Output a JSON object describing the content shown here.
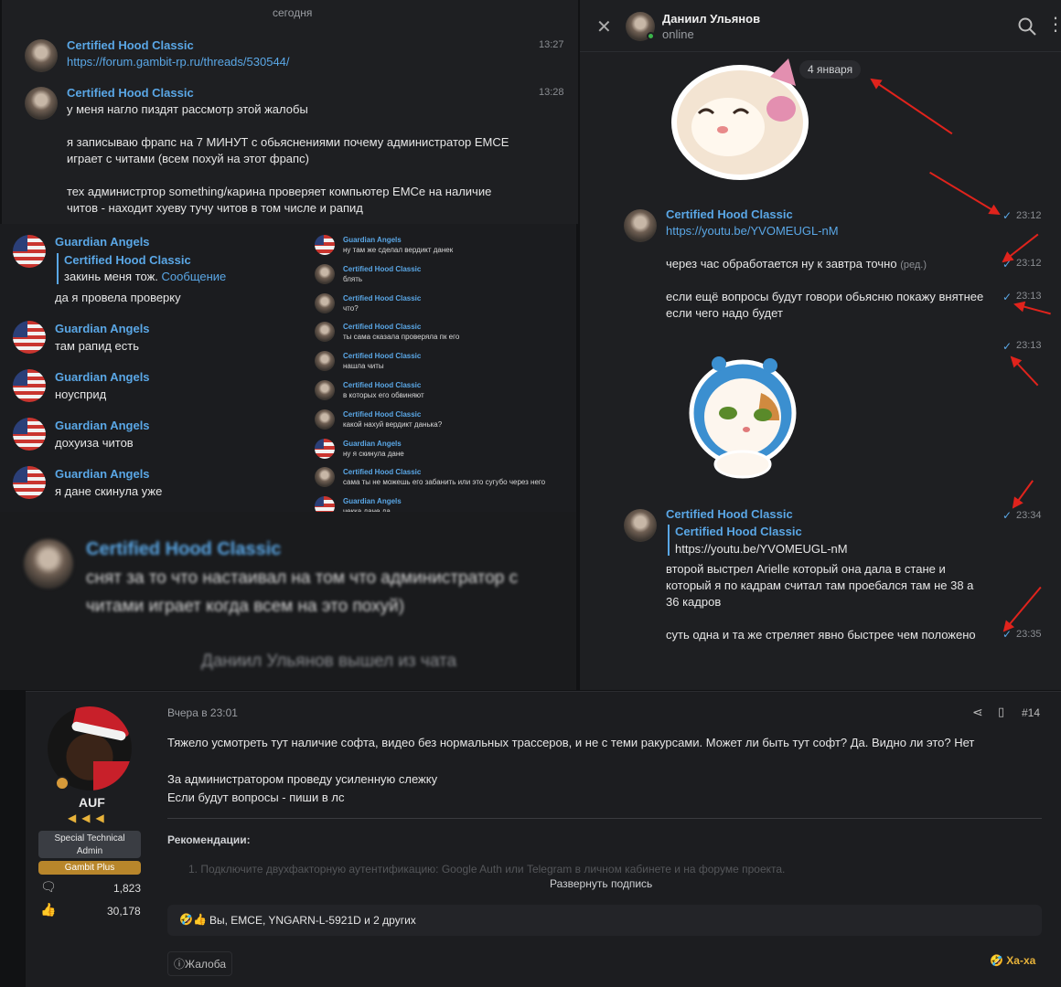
{
  "topleft": {
    "date": "сегодня",
    "msgs": [
      {
        "name": "Certified Hood Classic",
        "time": "13:27",
        "lines": [
          "https://forum.gambit-rp.ru/threads/530544/"
        ]
      },
      {
        "name": "Certified Hood Classic",
        "time": "13:28",
        "lines": [
          "у меня нагло пиздят рассмотр этой жалобы",
          "",
          "я записываю фрапс на 7 МИНУТ с обьяснениями почему администратор EMCE",
          "играет с читами (всем похуй на этот фрапс)",
          "",
          "тех администртор something/карина проверяет компьютер EMCe на наличие",
          "читов - находит хуеву тучу читов в том числе и рапид"
        ]
      }
    ]
  },
  "midleft": {
    "msgs": [
      {
        "name": "Guardian Angels",
        "reply_name": "Certified Hood Classic",
        "reply_text": "закинь меня тож.",
        "reply_link": "Сообщение",
        "text": "да я провела проверку"
      },
      {
        "name": "Guardian Angels",
        "text": "там рапид есть"
      },
      {
        "name": "Guardian Angels",
        "text": "ноусприд"
      },
      {
        "name": "Guardian Angels",
        "text": "дохуиза читов"
      },
      {
        "name": "Guardian Angels",
        "text": "я дане скинула уже"
      }
    ],
    "small": [
      {
        "name": "Guardian Angels",
        "text": "ну там же сделал вердикт данек"
      },
      {
        "name": "Certified Hood Classic",
        "text": "блять"
      },
      {
        "name": "Certified Hood Classic",
        "text": "что?"
      },
      {
        "name": "Certified Hood Classic",
        "text": "ты сама сказала проверяла пк его"
      },
      {
        "name": "Certified Hood Classic",
        "text": "нашла читы"
      },
      {
        "name": "Certified Hood Classic",
        "text": "в которых его обвиняют"
      },
      {
        "name": "Certified Hood Classic",
        "text": "какой нахуй вердикт данька?"
      },
      {
        "name": "Guardian Angels",
        "text": "ну я скинула дане"
      },
      {
        "name": "Certified Hood Classic",
        "text": "сама ты не можешь его забанить или это сугубо через него"
      },
      {
        "name": "Guardian Angels",
        "text": "чекка дане да"
      }
    ]
  },
  "blurred": {
    "name": "Certified Hood Classic",
    "line1": "снят за то что настаивал на том что администратор с",
    "line2": "читами играет когда всем на это похуй)",
    "left": "Даниил Ульянов вышел из чата"
  },
  "right": {
    "contact": "Даниил Ульянов",
    "status": "online",
    "date_chip": "4 января",
    "m1": {
      "name": "Certified Hood Classic",
      "link": "https://youtu.be/YVOMEUGL-nM",
      "time": "23:12"
    },
    "m2": {
      "text": "через час обработается ну к завтра точно",
      "edited": "(ред.)",
      "time": "23:12"
    },
    "m3": {
      "l1": "если ещё вопросы будут говори обьясню покажу внятнее",
      "l2": "если чего надо будет",
      "time": "23:13"
    },
    "m4": {
      "time": "23:13"
    },
    "m5": {
      "name": "Certified Hood Classic",
      "reply_name": "Certified Hood Classic",
      "reply_text": "https://youtu.be/YVOMEUGL-nM",
      "l1": "второй выстрел Arielle который она дала в стане и",
      "l2": "который я по кадрам считал там проебался там не 38 а",
      "l3": "36 кадров",
      "time": "23:34"
    },
    "m6": {
      "text": "суть одна и та же стреляет явно быстрее чем положено",
      "time": "23:35"
    }
  },
  "forum": {
    "user": "AUF",
    "role1": "Special Technical",
    "role2": "Admin",
    "badge": "Gambit Plus",
    "messages": "1,823",
    "likes": "30,178",
    "date": "Вчера в 23:01",
    "post_no": "#14",
    "p1": "Тяжело усмотреть тут наличие софта, видео без нормальных трассеров, и не с теми ракурсами. Может ли быть тут софт? Да. Видно ли это? Нет",
    "p2": "За администратором проведу усиленную слежку",
    "p3": "Если будут вопросы - пиши в лс",
    "rec_title": "Рекомендации:",
    "rec_item": "1. Подключите двухфакторную аутентификацию: Google Auth или Telegram в личном кабинете и на форуме проекта.",
    "expand": "Развернуть подпись",
    "reactions": "Вы, EMCE, YNGARN-L-5921D и 2 других",
    "report": "Жалоба",
    "haha": "Ха-ха"
  },
  "colors": {
    "accent": "#5aa7e6",
    "arrow": "#e0231c",
    "panel": "#1b1c1f",
    "badge": "#b8862b"
  }
}
